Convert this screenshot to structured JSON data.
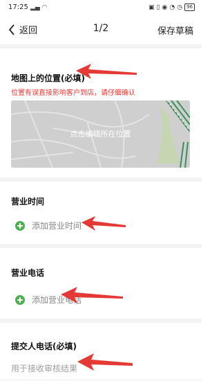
{
  "status_bar": {
    "time": "17:25",
    "battery": "96"
  },
  "navbar": {
    "back_label": "返回",
    "title": "1/2",
    "save_label": "保存草稿"
  },
  "location_section": {
    "title": "地图上的位置(必填)",
    "warning": "位置有误直接影响客户到店，请仔细确认",
    "map_label": "点击编辑所在位置"
  },
  "hours_section": {
    "title": "营业时间",
    "add_label": "添加营业时间"
  },
  "phone_section": {
    "title": "营业电话",
    "add_label": "添加营业电话"
  },
  "submitter_section": {
    "title": "提交人电话(必填)",
    "placeholder": "用于接收审核结果"
  },
  "colors": {
    "accent_green": "#4caf50",
    "warning_red": "#e53935",
    "arrow_red": "#e53935"
  }
}
